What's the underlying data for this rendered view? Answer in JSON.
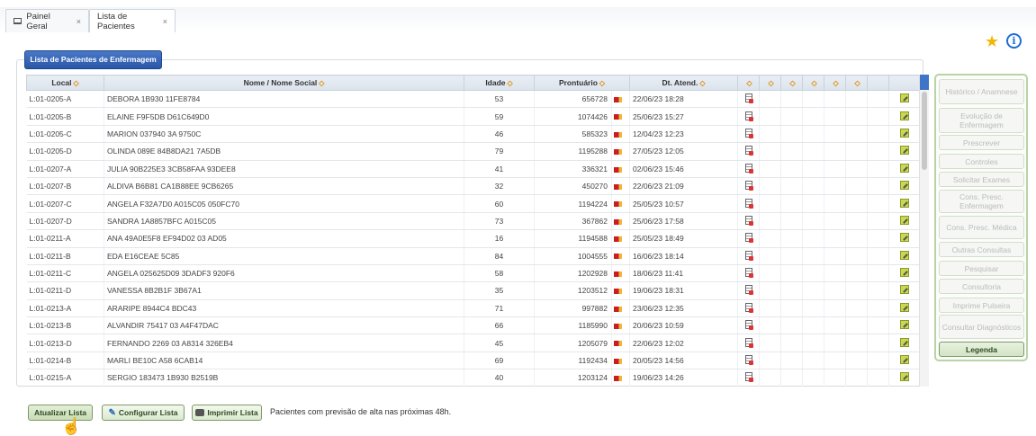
{
  "tabs": [
    {
      "label": "Painel Geral",
      "close": "×",
      "active": false
    },
    {
      "label": "Lista de Pacientes",
      "close": "×",
      "active": true
    }
  ],
  "panel_title": "Lista de Pacientes de Enfermagem",
  "columns": {
    "local": "Local",
    "nome": "Nome / Nome Social",
    "idade": "Idade",
    "prontuario": "Prontuário",
    "dt_atend": "Dt. Atend."
  },
  "rows": [
    {
      "local": "L:01-0205-A",
      "nome": "DEBORA 1B930 11FE8784",
      "idade": "53",
      "prontuario": "656728",
      "dt": "22/06/23 18:28"
    },
    {
      "local": "L:01-0205-B",
      "nome": "ELAINE F9F5DB D61C649D0",
      "idade": "59",
      "prontuario": "1074426",
      "dt": "25/06/23 15:27"
    },
    {
      "local": "L:01-0205-C",
      "nome": "MARION 037940 3A 9750C",
      "idade": "46",
      "prontuario": "585323",
      "dt": "12/04/23 12:23"
    },
    {
      "local": "L:01-0205-D",
      "nome": "OLINDA 089E 84B8DA21 7A5DB",
      "idade": "79",
      "prontuario": "1195288",
      "dt": "27/05/23 12:05"
    },
    {
      "local": "L:01-0207-A",
      "nome": "JULIA 90B225E3 3CB58FAA 93DEE8",
      "idade": "41",
      "prontuario": "336321",
      "dt": "02/06/23 15:46"
    },
    {
      "local": "L:01-0207-B",
      "nome": "ALDIVA B6B81 CA1B88EE 9CB6265",
      "idade": "32",
      "prontuario": "450270",
      "dt": "22/06/23 21:09"
    },
    {
      "local": "L:01-0207-C",
      "nome": "ANGELA F32A7D0 A015C05 050FC70",
      "idade": "60",
      "prontuario": "1194224",
      "dt": "25/05/23 10:57"
    },
    {
      "local": "L:01-0207-D",
      "nome": "SANDRA 1A8857BFC A015C05",
      "idade": "73",
      "prontuario": "367862",
      "dt": "25/06/23 17:58"
    },
    {
      "local": "L:01-0211-A",
      "nome": "ANA 49A0E5F8 EF94D02 03 AD05",
      "idade": "16",
      "prontuario": "1194588",
      "dt": "25/05/23 18:49"
    },
    {
      "local": "L:01-0211-B",
      "nome": "EDA E16CEAE 5C85",
      "idade": "84",
      "prontuario": "1004555",
      "dt": "16/06/23 18:14"
    },
    {
      "local": "L:01-0211-C",
      "nome": "ANGELA 025625D09 3DADF3 920F6",
      "idade": "58",
      "prontuario": "1202928",
      "dt": "18/06/23 11:41"
    },
    {
      "local": "L:01-0211-D",
      "nome": "VANESSA 8B2B1F 3B67A1",
      "idade": "35",
      "prontuario": "1203512",
      "dt": "19/06/23 18:31"
    },
    {
      "local": "L:01-0213-A",
      "nome": "ARARIPE 8944C4 BDC43",
      "idade": "71",
      "prontuario": "997882",
      "dt": "23/06/23 12:35"
    },
    {
      "local": "L:01-0213-B",
      "nome": "ALVANDIR 75417 03 A4F47DAC",
      "idade": "66",
      "prontuario": "1185990",
      "dt": "20/06/23 10:59"
    },
    {
      "local": "L:01-0213-D",
      "nome": "FERNANDO 2269 03 A8314 326EB4",
      "idade": "45",
      "prontuario": "1205079",
      "dt": "22/06/23 12:02"
    },
    {
      "local": "L:01-0214-B",
      "nome": "MARLI BE10C A58 6CAB14",
      "idade": "69",
      "prontuario": "1192434",
      "dt": "20/05/23 14:56"
    },
    {
      "local": "L:01-0215-A",
      "nome": "SERGIO 183473 1B930 B2519B",
      "idade": "40",
      "prontuario": "1203124",
      "dt": "19/06/23 14:26"
    }
  ],
  "side_buttons": [
    "Histórico / Anamnese",
    "Evolução de Enfermagem",
    "Prescrever",
    "Controles",
    "Solicitar Exames",
    "Cons. Presc. Enfermagem",
    "Cons. Presc. Médica",
    "Outras Consultas",
    "Pesquisar",
    "Consultoria",
    "Imprime Pulseira",
    "Consultar Diagnósticos",
    "Legenda"
  ],
  "bottom": {
    "atualizar": "Atualizar Lista",
    "configurar": "Configurar Lista",
    "imprimir": "Imprimir Lista",
    "note": "Pacientes com previsão de alta nas próximas 48h."
  },
  "icons": {
    "sort": "sort-icon",
    "flag": "alert-flag-icon",
    "doc": "document-icon",
    "edit": "edit-icon",
    "star": "star-icon",
    "info": "info-icon"
  },
  "colors": {
    "header_blue": "#2a57a7",
    "star": "#f2b705",
    "info": "#1f6fd1",
    "legend_green": "#7d9a69"
  }
}
